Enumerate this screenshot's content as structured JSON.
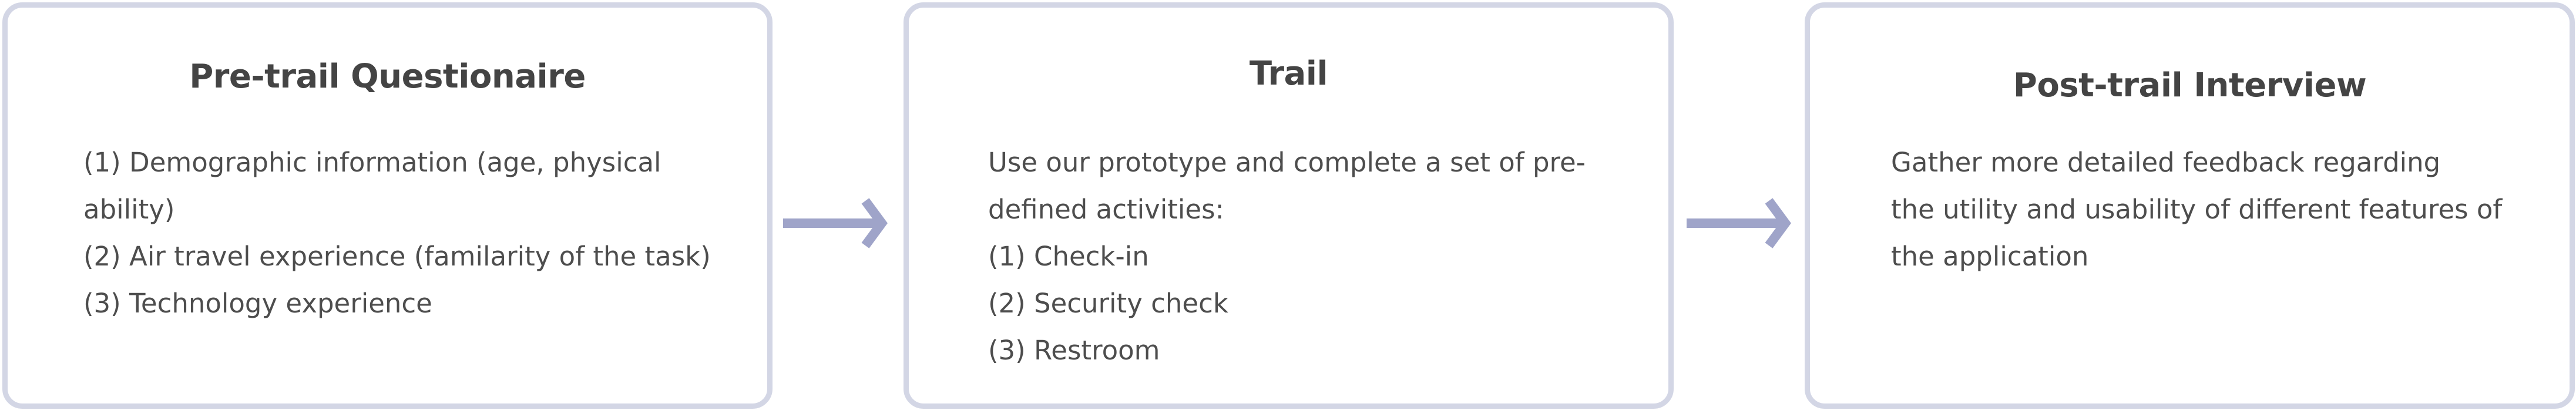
{
  "colors": {
    "box_border": "#d3d6e5",
    "arrow": "#9fa4c9",
    "text": "#4d4d4d"
  },
  "steps": [
    {
      "title": "Pre-trail Questionaire",
      "lines": [
        "(1) Demographic information (age, physical",
        "ability)",
        "(2) Air travel experience (familarity of the task)",
        "(3) Technology experience"
      ]
    },
    {
      "title": "Trail",
      "lines": [
        "Use our prototype and complete a set of pre-",
        "defined activities:",
        "(1) Check-in",
        "(2) Security check",
        "(3) Restroom"
      ]
    },
    {
      "title": "Post-trail Interview",
      "lines": [
        "Gather more detailed feedback regarding",
        "the utility and usability of different features of",
        "the application"
      ]
    }
  ]
}
